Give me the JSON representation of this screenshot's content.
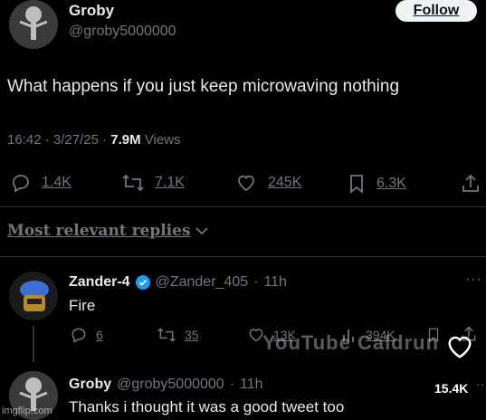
{
  "main_tweet": {
    "author_name": "Groby",
    "author_handle": "@groby5000000",
    "follow_label": "Follow",
    "text": "What happens if you just keep microwaving nothing",
    "time": "16:42",
    "date": "3/27/25",
    "views_count": "7.9M",
    "views_label": "Views",
    "replies": "1.4K",
    "reposts": "7.1K",
    "likes": "245K",
    "bookmarks": "6.3K"
  },
  "replies_filter": "Most relevant replies",
  "reply1": {
    "author_name": "Zander-4",
    "author_handle": "@Zander_405",
    "age": "11h",
    "text": "Fire",
    "replies": "6",
    "reposts": "35",
    "likes": "13K",
    "views": "394K"
  },
  "reply2": {
    "author_name": "Groby",
    "author_handle": "@groby5000000",
    "age": "11h",
    "text": "Thanks i thought it was a good tweet too",
    "likes": "15.4K"
  },
  "watermarks": {
    "youtube": "YouTube Caldrun",
    "imgflip": "imgflip.com"
  }
}
